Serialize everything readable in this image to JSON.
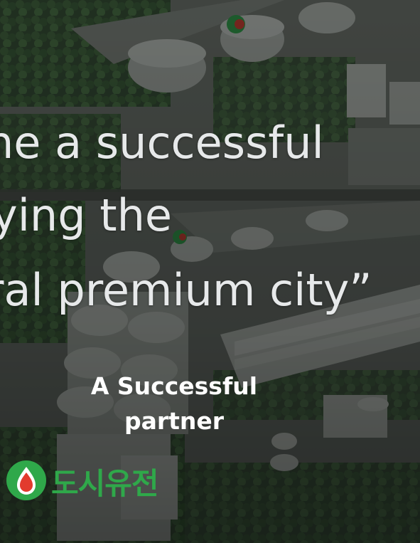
{
  "headline": {
    "line1": "ne a successful",
    "line2": "ying the",
    "line3": "ral premium city”"
  },
  "tagline": {
    "line1": "A Successful",
    "line2": "partner"
  },
  "logo": {
    "text": "도시유전",
    "colors": {
      "green": "#2fa84a",
      "red": "#e23b2e"
    }
  }
}
